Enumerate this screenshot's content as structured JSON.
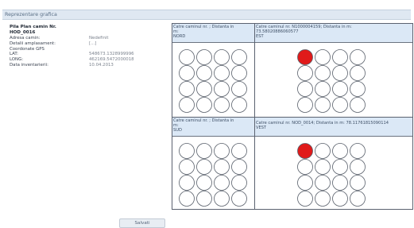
{
  "panel": {
    "title": "Reprezentare grafica"
  },
  "info": {
    "heading_line1": "Pila Plan camin Nr.",
    "heading_line2": "HOD_0016",
    "rows": [
      {
        "label": "Adresa camin:",
        "value": "Nedefinit"
      },
      {
        "label": "Detalii amplasament:",
        "value": "[...]"
      },
      {
        "label": "Coordonate GPS",
        "value": ""
      },
      {
        "label": "LAT:",
        "value": "548673.1328999996"
      },
      {
        "label": "LONG:",
        "value": "462169.5472000018"
      },
      {
        "label": "Data inventarierii:",
        "value": "10.04.2013"
      }
    ]
  },
  "quadrants": [
    {
      "lines": [
        "Catre caminul nr. ; Distanta in",
        "m:",
        "NORD"
      ],
      "filled": []
    },
    {
      "lines": [
        "Catre caminul nr. N1000004159; Distanta in m:",
        "73.58020886060577",
        "EST"
      ],
      "filled": [
        0
      ]
    },
    {
      "lines": [
        "Catre caminul nr. ; Distanta in",
        "m:",
        "SUD"
      ],
      "filled": []
    },
    {
      "lines": [
        "Catre caminul nr. NOD_0014; Distanta in m: 78.11761815090114",
        "VEST"
      ],
      "filled": [
        0
      ]
    }
  ],
  "colors": {
    "empty_fill": "#ffffff",
    "stroke": "#59606b",
    "occupied_fill": "#e01a1a"
  },
  "save_button": {
    "label": "Salvati"
  }
}
